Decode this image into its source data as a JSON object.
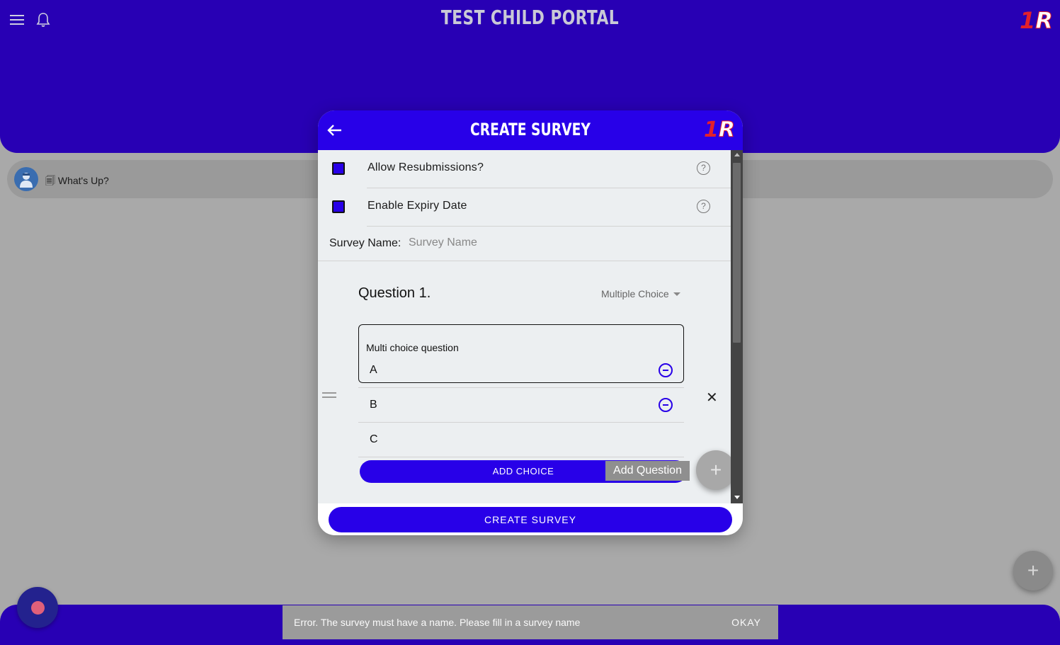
{
  "app": {
    "title": "TEST CHILD PORTAL",
    "logo_text": "1R"
  },
  "feed": {
    "item_text": "🗐 What's Up?"
  },
  "modal": {
    "title": "CREATE SURVEY",
    "logo_text": "1R",
    "options": [
      {
        "label": "Allow Resubmissions?",
        "checked": true
      },
      {
        "label": "Enable Expiry Date",
        "checked": true
      }
    ],
    "survey_name": {
      "label": "Survey Name:",
      "value": "",
      "placeholder": "Survey Name"
    },
    "question": {
      "title": "Question 1.",
      "type": "Multiple Choice",
      "text": "Multi choice question",
      "choices": [
        "A",
        "B",
        "C"
      ]
    },
    "add_choice_label": "ADD CHOICE",
    "tooltip": "Add Question",
    "create_label": "CREATE SURVEY"
  },
  "snackbar": {
    "message": "Error. The survey must have a name. Please fill in a survey name",
    "action": "OKAY"
  },
  "colors": {
    "header_bg": "#2800b4",
    "accent": "#2800e8",
    "overlay_bg": "#a9a9a9",
    "logo_red": "#e3202b"
  },
  "icons": {
    "menu": "hamburger-menu-icon",
    "notifications": "bell-icon",
    "back": "arrow-left-icon",
    "help": "question-circle-icon",
    "remove_choice": "minus-circle-icon",
    "close": "close-icon",
    "drag": "drag-handle-icon",
    "add": "plus-icon"
  }
}
